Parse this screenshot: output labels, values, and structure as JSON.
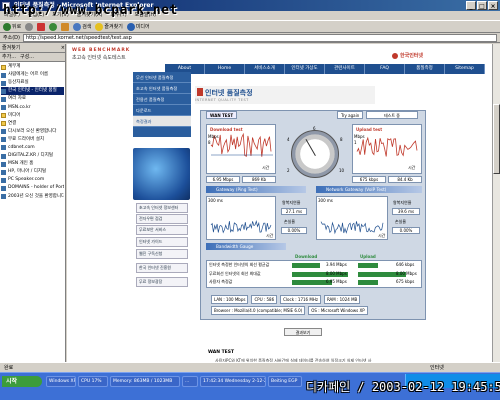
{
  "window": {
    "title": "인터넷 품질측정 - Microsoft Internet Explorer",
    "watermark_url": "http://www.bcpark.net"
  },
  "menubar": [
    "파일(F)",
    "편집(E)",
    "보기(V)",
    "즐겨찾기(A)",
    "도구(T)",
    "도움말(H)"
  ],
  "toolbar": {
    "back_label": "뒤로",
    "search_label": "검색",
    "favorites_label": "즐겨찾기",
    "media_label": "미디어"
  },
  "address": {
    "label": "주소(D)",
    "value": "http://speed.kornet.net/speedtest/test.asp",
    "go_label": "이동"
  },
  "favorites": {
    "header": "즐겨찾기",
    "add_label": "추가...",
    "organize_label": "구성...",
    "items": [
      "계무계",
      "사람에게는 어르 이름",
      "동산자료실",
      "한국 인터넷 - 인터넷 품질",
      "여러 자료",
      "MSN.co.kr",
      "미디어",
      "연결",
      "다시보러 오신 환영합니다",
      "무료 드라이버 설치",
      "cdbnet.com",
      "DIGITALZ.KR / 디지털",
      "MSN 개인 홈",
      "HP, 마니아 / 디지털",
      "PC Speaker.com",
      "DOMAINS - holder of Port",
      "2003년 오신 것을 환영합니다"
    ]
  },
  "site": {
    "logo": "WEB BENCHMARK",
    "subtitle": "초고속 인터넷 속도테스트",
    "partner": "한국인터넷",
    "nav": [
      "About",
      "Home",
      "서비스소개",
      "인터넷 가상도",
      "관련사이트",
      "FAQ",
      "품질측정",
      "Sitemap"
    ],
    "left_menu": [
      "무선 인터넷 품질측정",
      "초고속 인터넷 품질측정",
      "전용선 품질측정",
      "다운로드",
      "측정결과"
    ],
    "banners": [
      "초고속 인터넷 정보센터",
      "전자우편 점검",
      "무료보안 서비스",
      "인터넷 가이드",
      "웹진 구독신청",
      "한국 인터넷 진흥원",
      "무료 정보광장"
    ],
    "page_title": "인터넷 품질측정",
    "page_title_en": "INTERNET QUALITY TEST"
  },
  "test": {
    "tab_wan": "WAN TEST",
    "tab_retry": "Try again",
    "tab_current": "테스트 중",
    "download_label": "Download test",
    "download_unit": "Mbps",
    "download_scale_top": "8",
    "download_time_label": "시간",
    "download_speed": "6.95 Mbps",
    "download_bytes": "869 Kb",
    "upload_label": "Upload test",
    "upload_unit": "Mbps",
    "upload_scale_top": "1",
    "upload_time_label": "시간",
    "upload_speed": "675 kbps",
    "upload_bytes": "84.4 Kb",
    "dial_ticks": [
      "2",
      "4",
      "6",
      "8",
      "10"
    ],
    "ping_label": "Gateway (Ping Test)",
    "ping_unit": "300 ms",
    "ping_avg_label": "왕복지연율",
    "ping_avg": "27.1 ms",
    "ping_loss_label": "손실율",
    "ping_loss": "0.00%",
    "ping_axis": "시간",
    "voip_label": "Network Gateway (VoIP Test)",
    "voip_unit": "300 ms",
    "voip_avg_label": "왕복지연율",
    "voip_avg": "39.6 ms",
    "voip_loss_label": "손실율",
    "voip_loss": "0.00%",
    "voip_axis": "시간",
    "bandwidth_label": "Bandwidth Gauge",
    "col_download": "Download",
    "col_upload": "Upload",
    "rows": [
      {
        "label": "인터넷 측정한 인터넷의 회선 평균값",
        "down": "3.94 Mbps",
        "up": "646 kbps"
      },
      {
        "label": "무료회선 인터넷의 회선 최대값",
        "down": "8.00 Mbps",
        "up": "8.00 Mbps"
      },
      {
        "label": "사용자 측정값",
        "down": "6.95 Mbps",
        "up": "675 kbps"
      }
    ],
    "sys": {
      "lan_label": "LAN",
      "lan_value": "100 Mbps",
      "cpu_label": "CPU",
      "cpu_value": "586",
      "clock_label": "Clock",
      "clock_value": "1716 MHz",
      "ram_label": "RAM",
      "ram_value": "1024 MB",
      "browser_label": "Browser",
      "browser_value": "Mozilla/4.0 (compatible; MSIE 6.0)",
      "os_label": "OS",
      "os_value": "Microsoft Windows XP"
    },
    "result_button": "결과보기",
    "section_heading": "WAN TEST",
    "description": "사용자PC와 KT에 위치한 품질측정 서버간에 실제 데이터를 전송하여 일정크기 실제 인터넷 사"
  },
  "status": {
    "text": "완료",
    "zone": "인터넷"
  },
  "taskbar": {
    "start": "시작",
    "tasks": [
      "Windows XP",
      "CPU 17%",
      "Memory: 863MB / 1023MB",
      "...",
      "17:42:34 Wednesday 2-12-2003",
      "Beiting EGP"
    ],
    "timestamp": "디카페인 / 2003-02-12 19:45:51"
  },
  "colors": {
    "accent": "#1f4f8f",
    "brand_red": "#c0392b",
    "download_bar": "#2e8b3d",
    "upload_bar": "#2e8b3d"
  }
}
